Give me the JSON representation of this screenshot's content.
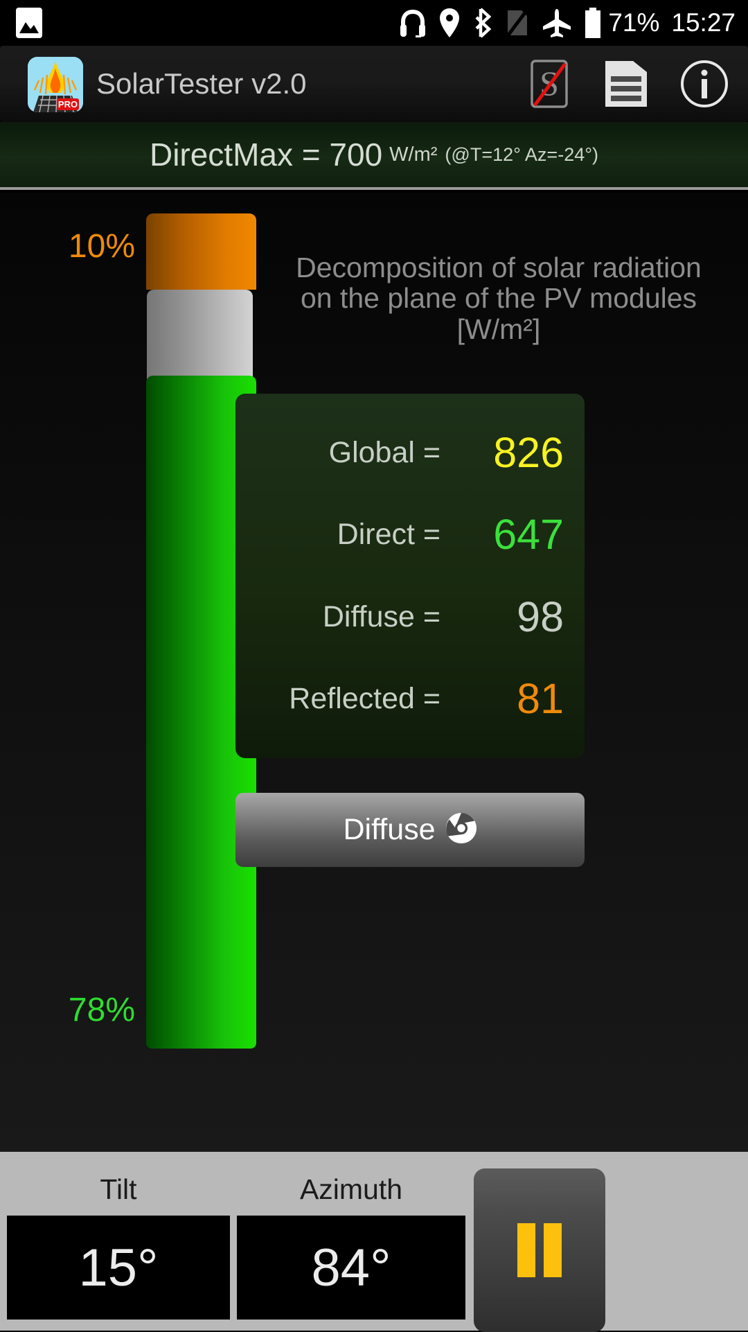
{
  "statusbar": {
    "icons": [
      "image-icon",
      "headset-icon",
      "location-icon",
      "bluetooth-icon",
      "sim-off-icon",
      "airplane-mode-icon",
      "battery-icon"
    ],
    "battery_percent": "71%",
    "clock": "15:27"
  },
  "appbar": {
    "title": "SolarTester v2.0",
    "app_icon_badge": "PRO",
    "actions": [
      {
        "name": "shading-off-button",
        "icon": "s-crossed-out-icon"
      },
      {
        "name": "report-button",
        "icon": "document-list-icon"
      },
      {
        "name": "info-button",
        "icon": "info-circle-icon"
      }
    ]
  },
  "banner": {
    "main": "DirectMax = 700",
    "unit": "W/m²",
    "conditions": "(@T=12° Az=-24°)"
  },
  "chart_data": {
    "type": "bar",
    "title": "Decomposition of solar radiation on the plane of the PV modules [W/m²]",
    "orientation": "vertical-stacked",
    "unit": "W/m²",
    "categories": [
      "Reflected",
      "Diffuse",
      "Direct"
    ],
    "values": [
      81,
      98,
      647
    ],
    "percent_labels": {
      "top": "10%",
      "bottom": "78%"
    },
    "percents": [
      10,
      12,
      78
    ],
    "colors": {
      "reflected": "#e07b00",
      "diffuse": "#bcbcbc",
      "direct": "#18c409",
      "global": "#f8f222"
    },
    "total_label": "Global",
    "total_value": 826,
    "ylim": [
      0,
      826
    ],
    "grid": false,
    "legend": "none"
  },
  "caption": "Decomposition of solar radiation on the plane of the PV modules [W/m²]",
  "values_panel": {
    "rows": [
      {
        "label": "Global =",
        "value": "826",
        "color": "#f8f222"
      },
      {
        "label": "Direct =",
        "value": "647",
        "color": "#3ce03c"
      },
      {
        "label": "Diffuse =",
        "value": "98",
        "color": "#c8cfc6"
      },
      {
        "label": "Reflected =",
        "value": "81",
        "color": "#f08a09"
      }
    ]
  },
  "diffuse_button": {
    "label": "Diffuse",
    "icon": "chrome-browser-icon"
  },
  "bottombar": {
    "tilt": {
      "label": "Tilt",
      "value": "15°"
    },
    "azimuth": {
      "label": "Azimuth",
      "value": "84°"
    },
    "pause_button": {
      "name": "pause-button",
      "icon": "pause-icon"
    }
  }
}
